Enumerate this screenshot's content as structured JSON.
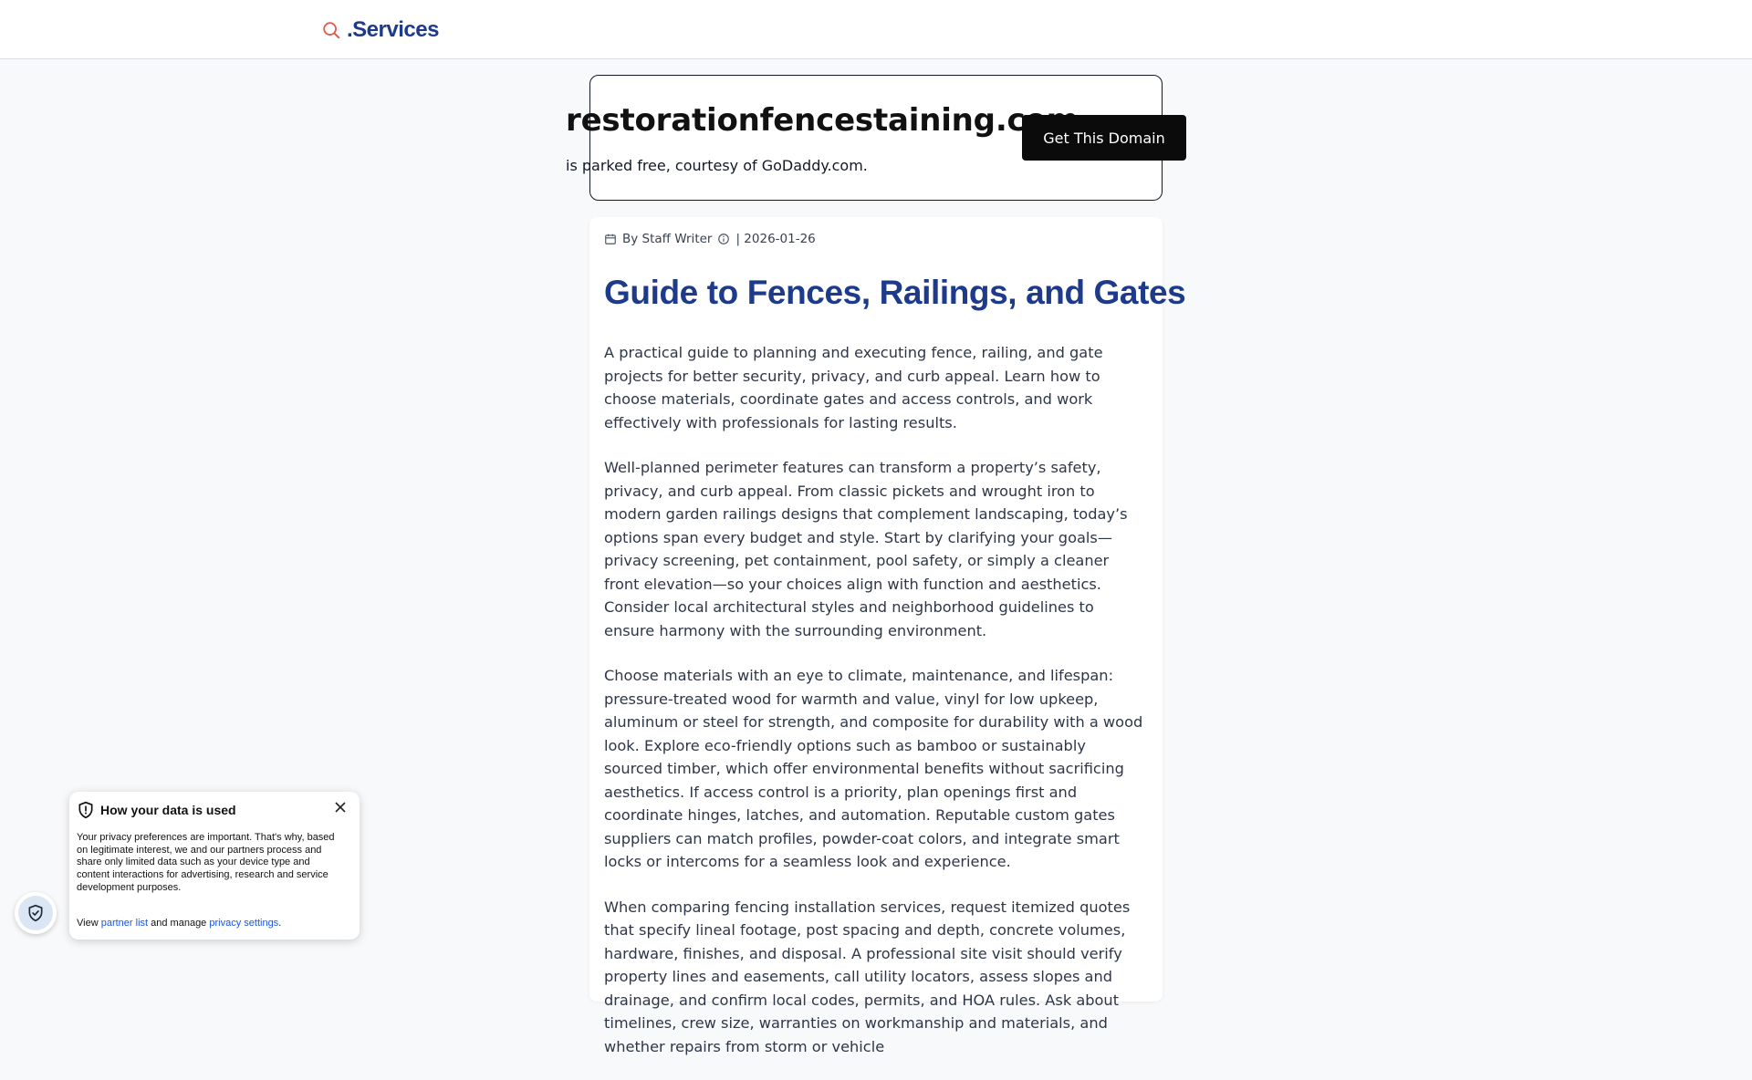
{
  "header": {
    "brand": ".Services"
  },
  "domain_banner": {
    "domain": "restorationfencestaining.com",
    "subtitle": "is parked free, courtesy of GoDaddy.com.",
    "cta_label": "Get This Domain"
  },
  "article": {
    "author": "By Staff Writer",
    "date": "| 2026-01-26",
    "title": "Guide to Fences, Railings, and Gates",
    "paragraphs": [
      "A practical guide to planning and executing fence, railing, and gate projects for better security, privacy, and curb appeal. Learn how to choose materials, coordinate gates and access controls, and work effectively with professionals for lasting results.",
      "Well-planned perimeter features can transform a property’s safety, privacy, and curb appeal. From classic pickets and wrought iron to modern garden railings designs that complement landscaping, today’s options span every budget and style. Start by clarifying your goals—privacy screening, pet containment, pool safety, or simply a cleaner front elevation—so your choices align with function and aesthetics. Consider local architectural styles and neighborhood guidelines to ensure harmony with the surrounding environment.",
      "Choose materials with an eye to climate, maintenance, and lifespan: pressure-treated wood for warmth and value, vinyl for low upkeep, aluminum or steel for strength, and composite for durability with a wood look. Explore eco-friendly options such as bamboo or sustainably sourced timber, which offer environmental benefits without sacrificing aesthetics. If access control is a priority, plan openings first and coordinate hinges, latches, and automation. Reputable custom gates suppliers can match profiles, powder-coat colors, and integrate smart locks or intercoms for a seamless look and experience.",
      "When comparing fencing installation services, request itemized quotes that specify lineal footage, post spacing and depth, concrete volumes, hardware, finishes, and disposal. A professional site visit should verify property lines and easements, call utility locators, assess slopes and drainage, and confirm local codes, permits, and HOA rules. Ask about timelines, crew size, warranties on workmanship and materials, and whether repairs from storm or vehicle"
    ]
  },
  "privacy_popup": {
    "title": "How your data is used",
    "body": "Your privacy preferences are important. That's why, based on legitimate interest, we and our partners process and share only limited data such as your device type and content interactions for advertising, research and service development purposes.",
    "footer_prefix": "View",
    "partner_link": "partner list",
    "footer_middle": "and manage",
    "settings_link": "privacy settings",
    "footer_suffix": "."
  },
  "colors": {
    "brand_blue": "#1e3a8a",
    "search_icon_red": "#e8574a",
    "cta_bg": "#0b0b0b",
    "link_blue": "#1a56db"
  },
  "icons": [
    "search-icon",
    "calendar-icon",
    "info-icon",
    "shield-icon",
    "close-icon",
    "shield-check-icon"
  ]
}
